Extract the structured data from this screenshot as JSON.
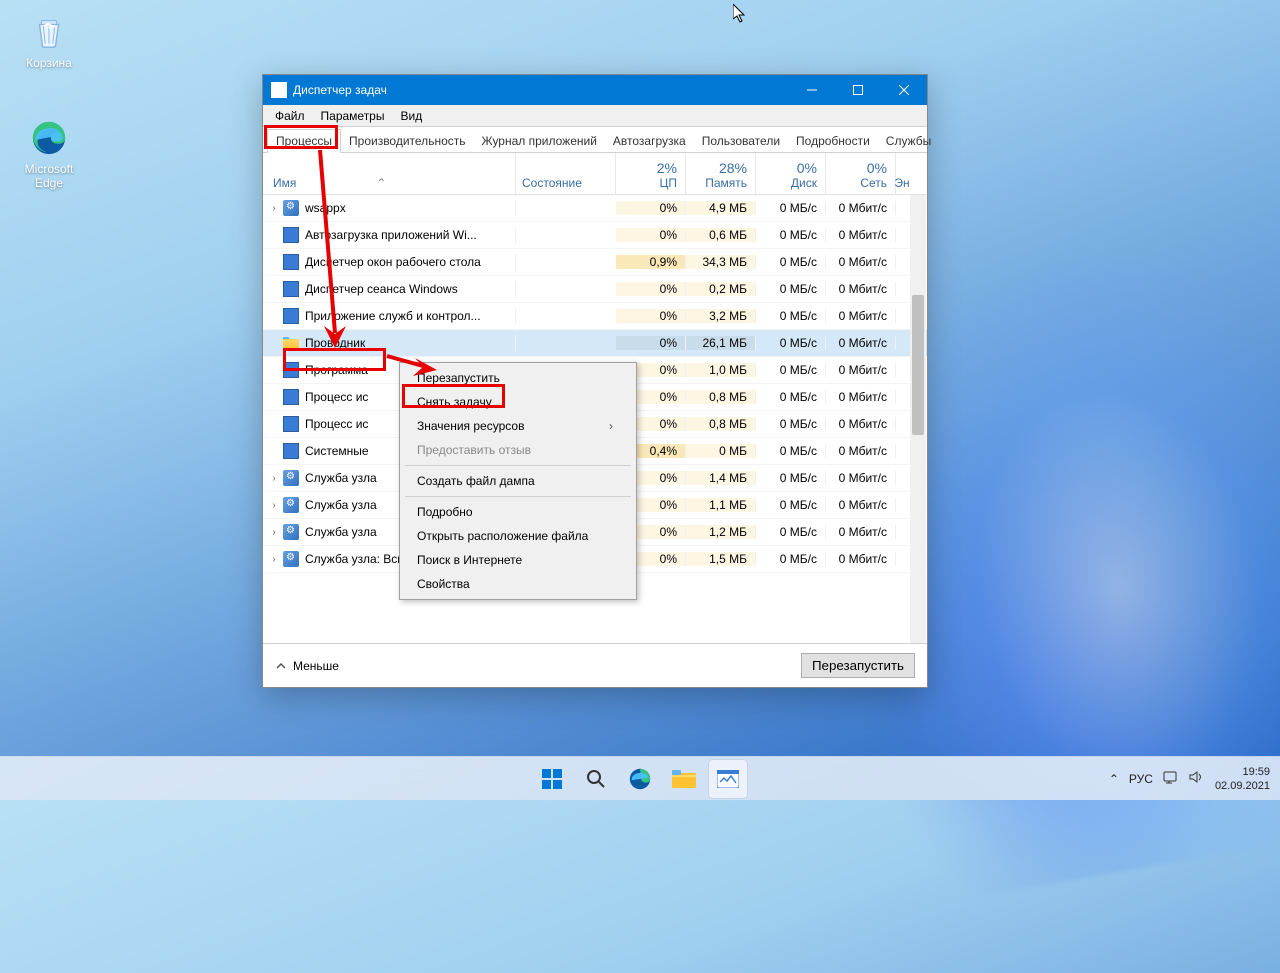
{
  "desktop": {
    "recycle": "Корзина",
    "edge": "Microsoft Edge"
  },
  "window": {
    "title": "Диспетчер задач",
    "menu": {
      "file": "Файл",
      "options": "Параметры",
      "view": "Вид"
    },
    "tabs": {
      "processes": "Процессы",
      "performance": "Производительность",
      "apphistory": "Журнал приложений",
      "startup": "Автозагрузка",
      "users": "Пользователи",
      "details": "Подробности",
      "services": "Службы"
    },
    "cols": {
      "name": "Имя",
      "state": "Состояние",
      "cpu_pct": "2%",
      "cpu": "ЦП",
      "mem_pct": "28%",
      "mem": "Память",
      "disk_pct": "0%",
      "disk": "Диск",
      "net_pct": "0%",
      "net": "Сеть",
      "trunc": "Эн"
    },
    "rows": [
      {
        "exp": true,
        "icon": "gear",
        "name": "wsappx",
        "cpu": "0%",
        "mem": "4,9 МБ",
        "disk": "0 МБ/с",
        "net": "0 Мбит/с"
      },
      {
        "exp": false,
        "icon": "app",
        "name": "Автозагрузка приложений Wi...",
        "cpu": "0%",
        "mem": "0,6 МБ",
        "disk": "0 МБ/с",
        "net": "0 Мбит/с"
      },
      {
        "exp": false,
        "icon": "app",
        "name": "Диспетчер окон рабочего стола",
        "cpu": "0,9%",
        "mem": "34,3 МБ",
        "disk": "0 МБ/с",
        "net": "0 Мбит/с",
        "cpuhi": true
      },
      {
        "exp": false,
        "icon": "app",
        "name": "Диспетчер сеанса  Windows",
        "cpu": "0%",
        "mem": "0,2 МБ",
        "disk": "0 МБ/с",
        "net": "0 Мбит/с"
      },
      {
        "exp": false,
        "icon": "app",
        "name": "Приложение служб и контрол...",
        "cpu": "0%",
        "mem": "3,2 МБ",
        "disk": "0 МБ/с",
        "net": "0 Мбит/с"
      },
      {
        "exp": false,
        "icon": "folder",
        "name": "Проводник",
        "cpu": "0%",
        "mem": "26,1 МБ",
        "disk": "0 МБ/с",
        "net": "0 Мбит/с",
        "sel": true
      },
      {
        "exp": false,
        "icon": "app",
        "name": "Программа",
        "cpu": "0%",
        "mem": "1,0 МБ",
        "disk": "0 МБ/с",
        "net": "0 Мбит/с"
      },
      {
        "exp": false,
        "icon": "app",
        "name": "Процесс ис",
        "cpu": "0%",
        "mem": "0,8 МБ",
        "disk": "0 МБ/с",
        "net": "0 Мбит/с"
      },
      {
        "exp": false,
        "icon": "app",
        "name": "Процесс ис",
        "cpu": "0%",
        "mem": "0,8 МБ",
        "disk": "0 МБ/с",
        "net": "0 Мбит/с"
      },
      {
        "exp": false,
        "icon": "app",
        "name": "Системные",
        "cpu": "0,4%",
        "mem": "0 МБ",
        "disk": "0 МБ/с",
        "net": "0 Мбит/с",
        "cpuhi": true
      },
      {
        "exp": true,
        "icon": "gear",
        "name": "Служба узла",
        "cpu": "0%",
        "mem": "1,4 МБ",
        "disk": "0 МБ/с",
        "net": "0 Мбит/с"
      },
      {
        "exp": true,
        "icon": "gear",
        "name": "Служба узла",
        "cpu": "0%",
        "mem": "1,1 МБ",
        "disk": "0 МБ/с",
        "net": "0 Мбит/с"
      },
      {
        "exp": true,
        "icon": "gear",
        "name": "Служба узла",
        "cpu": "0%",
        "mem": "1,2 МБ",
        "disk": "0 МБ/с",
        "net": "0 Мбит/с"
      },
      {
        "exp": true,
        "icon": "gear",
        "name": "Служба узла: Вспомогательна...",
        "cpu": "0%",
        "mem": "1,5 МБ",
        "disk": "0 МБ/с",
        "net": "0 Мбит/с"
      }
    ],
    "footer": {
      "less": "Меньше",
      "restart": "Перезапустить"
    }
  },
  "context_menu": {
    "restart": "Перезапустить",
    "endtask": "Снять задачу",
    "resources": "Значения ресурсов",
    "feedback": "Предоставить отзыв",
    "dump": "Создать файл дампа",
    "details": "Подробно",
    "openloc": "Открыть расположение файла",
    "search": "Поиск в Интернете",
    "props": "Свойства"
  },
  "taskbar": {
    "lang": "РУС",
    "time": "19:59",
    "date": "02.09.2021"
  }
}
